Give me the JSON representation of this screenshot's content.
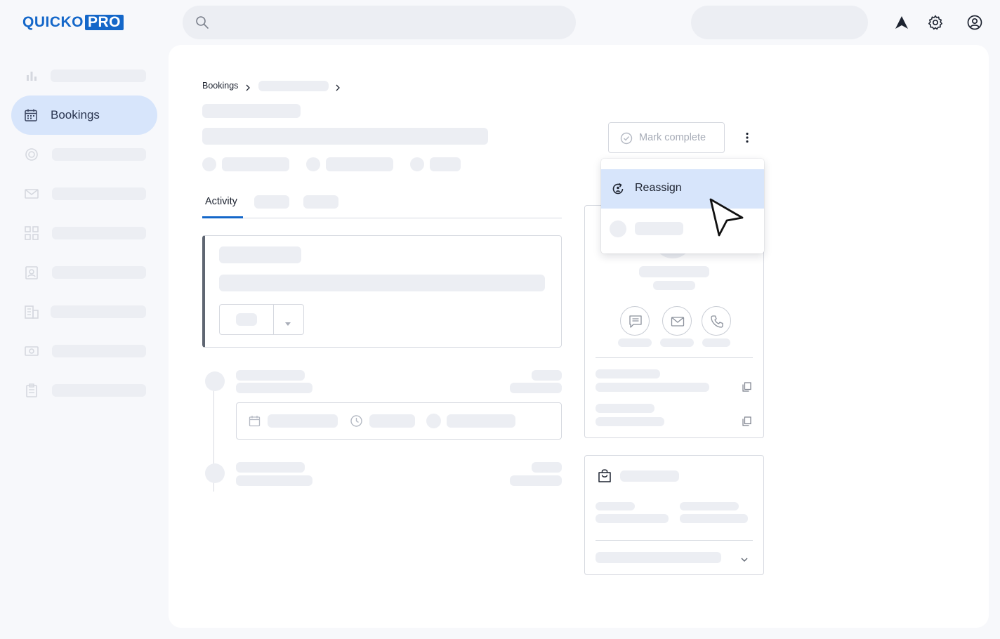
{
  "app": {
    "logo_main": "QUICKO",
    "logo_badge": "PRO",
    "brand_color": "#1467c9"
  },
  "topbar": {
    "icons": [
      "search-icon",
      "navigation-arrow-icon",
      "gear-icon",
      "account-circle-icon"
    ]
  },
  "sidebar": {
    "active_item": {
      "label": "Bookings",
      "icon": "calendar-icon"
    },
    "icons": [
      "bar-chart-icon",
      "calendar-icon",
      "target-icon",
      "mail-icon",
      "grid-icon",
      "id-badge-icon",
      "building-icon",
      "cash-icon",
      "clipboard-icon"
    ]
  },
  "breadcrumb": {
    "root": "Bookings"
  },
  "tabs": {
    "active": "Activity"
  },
  "actions": {
    "mark_complete": "Mark complete",
    "more_icon": "kebab-menu-icon"
  },
  "menu": {
    "highlighted_item": "Reassign",
    "highlighted_icon": "reassign-icon"
  },
  "colors": {
    "accent": "#1467c9",
    "selected_bg": "#d7e5fb",
    "skeleton": "#eceef3"
  }
}
